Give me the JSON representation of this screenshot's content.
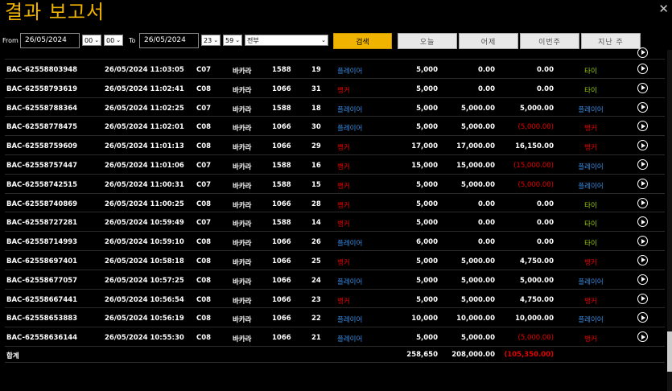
{
  "title": "결과 보고서",
  "close_glyph": "✕",
  "filter": {
    "from_label": "From",
    "from_date": "26/05/2024",
    "from_hour": "00",
    "from_min": "00",
    "to_label": "To",
    "to_date": "26/05/2024",
    "to_hour": "23",
    "to_min": "59",
    "type_value": "전부",
    "search_label": "검색",
    "today_label": "오늘",
    "yesterday_label": "어제",
    "this_week_label": "이번주",
    "last_week_label": "지난 주"
  },
  "colors": {
    "accent": "#f0b400",
    "player": "#3a8ee6",
    "banker": "#e60000",
    "tie": "#99cc00",
    "negative": "#e60000"
  },
  "rows": [
    {
      "id": "BAC-62558803948",
      "time": "26/05/2024 11:03:05",
      "table": "C07",
      "game": "바카라",
      "round": "1588",
      "hand": "19",
      "bet": "플레이어",
      "bet_type": "player",
      "amount": "5,000",
      "valid": "0.00",
      "win": "0.00",
      "win_neg": false,
      "result": "타이",
      "result_type": "tie"
    },
    {
      "id": "BAC-62558793619",
      "time": "26/05/2024 11:02:41",
      "table": "C08",
      "game": "바카라",
      "round": "1066",
      "hand": "31",
      "bet": "뱅커",
      "bet_type": "banker",
      "amount": "5,000",
      "valid": "0.00",
      "win": "0.00",
      "win_neg": false,
      "result": "타이",
      "result_type": "tie"
    },
    {
      "id": "BAC-62558788364",
      "time": "26/05/2024 11:02:25",
      "table": "C07",
      "game": "바카라",
      "round": "1588",
      "hand": "18",
      "bet": "플레이어",
      "bet_type": "player",
      "amount": "5,000",
      "valid": "5,000.00",
      "win": "5,000.00",
      "win_neg": false,
      "result": "플레이어",
      "result_type": "player"
    },
    {
      "id": "BAC-62558778475",
      "time": "26/05/2024 11:02:01",
      "table": "C08",
      "game": "바카라",
      "round": "1066",
      "hand": "30",
      "bet": "플레이어",
      "bet_type": "player",
      "amount": "5,000",
      "valid": "5,000.00",
      "win": "(5,000.00)",
      "win_neg": true,
      "result": "뱅커",
      "result_type": "banker"
    },
    {
      "id": "BAC-62558759609",
      "time": "26/05/2024 11:01:13",
      "table": "C08",
      "game": "바카라",
      "round": "1066",
      "hand": "29",
      "bet": "뱅커",
      "bet_type": "banker",
      "amount": "17,000",
      "valid": "17,000.00",
      "win": "16,150.00",
      "win_neg": false,
      "result": "뱅커",
      "result_type": "banker"
    },
    {
      "id": "BAC-62558757447",
      "time": "26/05/2024 11:01:06",
      "table": "C07",
      "game": "바카라",
      "round": "1588",
      "hand": "16",
      "bet": "뱅커",
      "bet_type": "banker",
      "amount": "15,000",
      "valid": "15,000.00",
      "win": "(15,000.00)",
      "win_neg": true,
      "result": "플레이어",
      "result_type": "player"
    },
    {
      "id": "BAC-62558742515",
      "time": "26/05/2024 11:00:31",
      "table": "C07",
      "game": "바카라",
      "round": "1588",
      "hand": "15",
      "bet": "뱅커",
      "bet_type": "banker",
      "amount": "5,000",
      "valid": "5,000.00",
      "win": "(5,000.00)",
      "win_neg": true,
      "result": "플레이어",
      "result_type": "player"
    },
    {
      "id": "BAC-62558740869",
      "time": "26/05/2024 11:00:25",
      "table": "C08",
      "game": "바카라",
      "round": "1066",
      "hand": "28",
      "bet": "뱅커",
      "bet_type": "banker",
      "amount": "5,000",
      "valid": "0.00",
      "win": "0.00",
      "win_neg": false,
      "result": "타이",
      "result_type": "tie"
    },
    {
      "id": "BAC-62558727281",
      "time": "26/05/2024 10:59:49",
      "table": "C07",
      "game": "바카라",
      "round": "1588",
      "hand": "14",
      "bet": "뱅커",
      "bet_type": "banker",
      "amount": "5,000",
      "valid": "0.00",
      "win": "0.00",
      "win_neg": false,
      "result": "타이",
      "result_type": "tie"
    },
    {
      "id": "BAC-62558714993",
      "time": "26/05/2024 10:59:10",
      "table": "C08",
      "game": "바카라",
      "round": "1066",
      "hand": "26",
      "bet": "플레이어",
      "bet_type": "player",
      "amount": "6,000",
      "valid": "0.00",
      "win": "0.00",
      "win_neg": false,
      "result": "타이",
      "result_type": "tie"
    },
    {
      "id": "BAC-62558697401",
      "time": "26/05/2024 10:58:18",
      "table": "C08",
      "game": "바카라",
      "round": "1066",
      "hand": "25",
      "bet": "뱅커",
      "bet_type": "banker",
      "amount": "5,000",
      "valid": "5,000.00",
      "win": "4,750.00",
      "win_neg": false,
      "result": "뱅커",
      "result_type": "banker"
    },
    {
      "id": "BAC-62558677057",
      "time": "26/05/2024 10:57:25",
      "table": "C08",
      "game": "바카라",
      "round": "1066",
      "hand": "24",
      "bet": "플레이어",
      "bet_type": "player",
      "amount": "5,000",
      "valid": "5,000.00",
      "win": "5,000.00",
      "win_neg": false,
      "result": "플레이어",
      "result_type": "player"
    },
    {
      "id": "BAC-62558667441",
      "time": "26/05/2024 10:56:54",
      "table": "C08",
      "game": "바카라",
      "round": "1066",
      "hand": "23",
      "bet": "뱅커",
      "bet_type": "banker",
      "amount": "5,000",
      "valid": "5,000.00",
      "win": "4,750.00",
      "win_neg": false,
      "result": "뱅커",
      "result_type": "banker"
    },
    {
      "id": "BAC-62558653883",
      "time": "26/05/2024 10:56:19",
      "table": "C08",
      "game": "바카라",
      "round": "1066",
      "hand": "22",
      "bet": "플레이어",
      "bet_type": "player",
      "amount": "10,000",
      "valid": "10,000.00",
      "win": "10,000.00",
      "win_neg": false,
      "result": "플레이어",
      "result_type": "player"
    },
    {
      "id": "BAC-62558636144",
      "time": "26/05/2024 10:55:30",
      "table": "C08",
      "game": "바카라",
      "round": "1066",
      "hand": "21",
      "bet": "플레이어",
      "bet_type": "player",
      "amount": "5,000",
      "valid": "5,000.00",
      "win": "(5,000.00)",
      "win_neg": true,
      "result": "뱅커",
      "result_type": "banker"
    }
  ],
  "total": {
    "label": "합계",
    "amount": "258,650",
    "valid": "208,000.00",
    "win": "(105,350.00)"
  }
}
